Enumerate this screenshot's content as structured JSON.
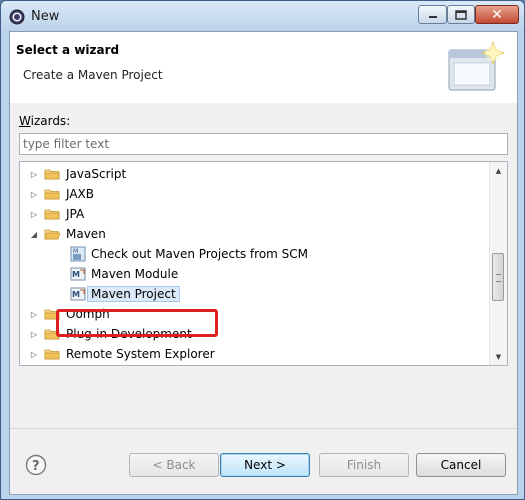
{
  "window": {
    "title": "New",
    "controls": {
      "minimize": "–",
      "maximize": "□",
      "close": "✕"
    }
  },
  "banner": {
    "title": "Select a wizard",
    "description": "Create a Maven Project"
  },
  "wizards_label": {
    "underlined": "W",
    "rest": "izards:"
  },
  "filter": {
    "placeholder": "type filter text",
    "value": ""
  },
  "tree": {
    "items": [
      {
        "label": "JavaScript",
        "type": "folder",
        "expanded": false
      },
      {
        "label": "JAXB",
        "type": "folder",
        "expanded": false
      },
      {
        "label": "JPA",
        "type": "folder",
        "expanded": false
      },
      {
        "label": "Maven",
        "type": "folder",
        "expanded": true
      },
      {
        "label": "Check out Maven Projects from SCM",
        "type": "maven-scm"
      },
      {
        "label": "Maven Module",
        "type": "maven"
      },
      {
        "label": "Maven Project",
        "type": "maven",
        "selected": true
      },
      {
        "label": "Oomph",
        "type": "folder",
        "expanded": false
      },
      {
        "label": "Plug-in Development",
        "type": "folder",
        "expanded": false
      },
      {
        "label": "Remote System Explorer",
        "type": "folder",
        "expanded": false
      }
    ]
  },
  "buttons": {
    "back": "< Back",
    "next": "Next >",
    "finish": "Finish",
    "cancel": "Cancel"
  },
  "colors": {
    "highlight": "#e02020",
    "selection": "#dbe9f9",
    "folder": "#f1c15b"
  },
  "icons": {
    "app": "eclipse-icon",
    "banner": "wizard-banner-icon",
    "folder": "folder-icon",
    "maven": "maven-icon",
    "help": "help-icon"
  }
}
